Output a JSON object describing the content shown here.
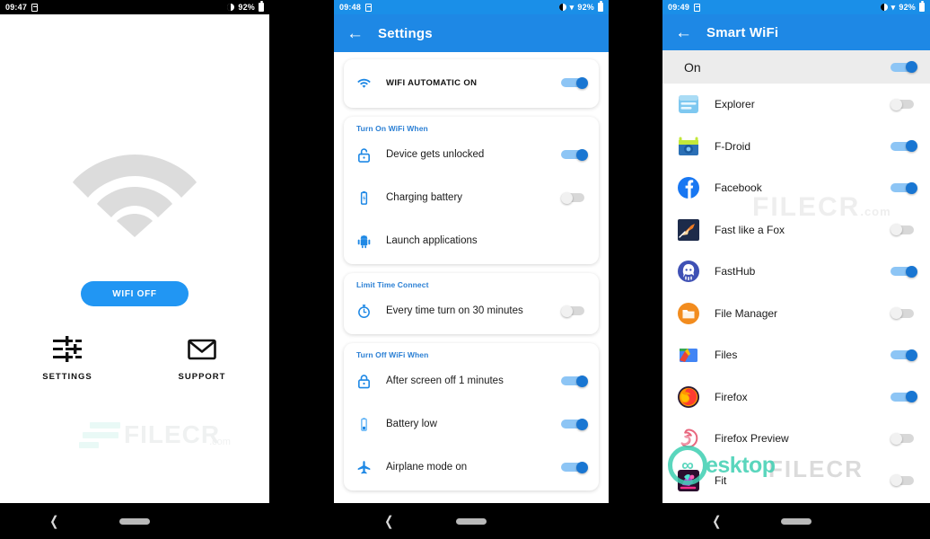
{
  "panel1": {
    "status": {
      "time": "09:47",
      "battery": "92%",
      "sim_icon": "sim-card-icon",
      "brightness_icon": "brightness-icon",
      "battery_icon": "battery-icon"
    },
    "wifi_illustration_icon": "wifi-signal-icon",
    "primary_button": "WIFI OFF",
    "actions": [
      {
        "label": "SETTINGS",
        "icon": "sliders-icon"
      },
      {
        "label": "SUPPORT",
        "icon": "envelope-icon"
      }
    ],
    "watermark": {
      "text": "FILECR",
      "sub": ".com"
    },
    "nav": {
      "back_icon": "back-chevron-icon",
      "home_icon": "home-pill-icon"
    }
  },
  "panel2": {
    "status": {
      "time": "09:48",
      "battery": "92%",
      "sim_icon": "sim-card-icon",
      "brightness_icon": "brightness-icon",
      "wifi_icon": "wifi-status-icon",
      "battery_icon": "battery-icon"
    },
    "appbar": {
      "back_icon": "back-arrow-icon",
      "title": "Settings"
    },
    "main_toggle": {
      "label": "WIFI AUTOMATIC ON",
      "icon": "wifi-icon",
      "state": "on"
    },
    "sections": [
      {
        "title": "Turn On WiFi When",
        "rows": [
          {
            "label": "Device gets unlocked",
            "icon": "unlocked-padlock-icon",
            "state": "on"
          },
          {
            "label": "Charging battery",
            "icon": "charging-battery-icon",
            "state": "off"
          },
          {
            "label": "Launch applications",
            "icon": "android-robot-icon",
            "state": "none"
          }
        ]
      },
      {
        "title": "Limit Time Connect",
        "rows": [
          {
            "label": "Every time turn on 30 minutes",
            "icon": "stopwatch-icon",
            "state": "off"
          }
        ]
      },
      {
        "title": "Turn Off WiFi When",
        "rows": [
          {
            "label": "After screen off 1 minutes",
            "icon": "locked-padlock-icon",
            "state": "on"
          },
          {
            "label": "Battery low",
            "icon": "battery-low-icon",
            "state": "on"
          },
          {
            "label": "Airplane mode on",
            "icon": "airplane-icon",
            "state": "on"
          }
        ]
      }
    ],
    "nav": {
      "back_icon": "back-chevron-icon",
      "home_icon": "home-pill-icon"
    }
  },
  "panel3": {
    "status": {
      "time": "09:49",
      "battery": "92%",
      "sim_icon": "sim-card-icon",
      "brightness_icon": "brightness-icon",
      "wifi_icon": "wifi-status-icon",
      "battery_icon": "battery-icon"
    },
    "appbar": {
      "back_icon": "back-arrow-icon",
      "title": "Smart WiFi"
    },
    "master": {
      "label": "On",
      "state": "on"
    },
    "apps": [
      {
        "label": "Explorer",
        "icon": "explorer-app-icon",
        "state": "off"
      },
      {
        "label": "F-Droid",
        "icon": "fdroid-app-icon",
        "state": "on"
      },
      {
        "label": "Facebook",
        "icon": "facebook-app-icon",
        "state": "on"
      },
      {
        "label": "Fast like a Fox",
        "icon": "fast-like-a-fox-app-icon",
        "state": "off"
      },
      {
        "label": "FastHub",
        "icon": "fasthub-app-icon",
        "state": "on"
      },
      {
        "label": "File Manager",
        "icon": "file-manager-app-icon",
        "state": "off"
      },
      {
        "label": "Files",
        "icon": "files-app-icon",
        "state": "on"
      },
      {
        "label": "Firefox",
        "icon": "firefox-app-icon",
        "state": "on"
      },
      {
        "label": "Firefox Preview",
        "icon": "firefox-preview-app-icon",
        "state": "off"
      },
      {
        "label": "Fit",
        "icon": "fit-app-icon",
        "state": "off"
      }
    ],
    "watermarks": {
      "filecr": "FILECR",
      "filecr_sub": ".com",
      "desktop": "esktop"
    },
    "nav": {
      "back_icon": "back-chevron-icon",
      "home_icon": "home-pill-icon"
    }
  },
  "colors": {
    "accent": "#1E88E5",
    "toggle_on": "#1976D2",
    "toggle_on_track": "#8DC5F5",
    "toggle_off": "#D8D8D8",
    "section_title": "#2A7FD4",
    "watermark_teal": "#3ECFB2"
  }
}
